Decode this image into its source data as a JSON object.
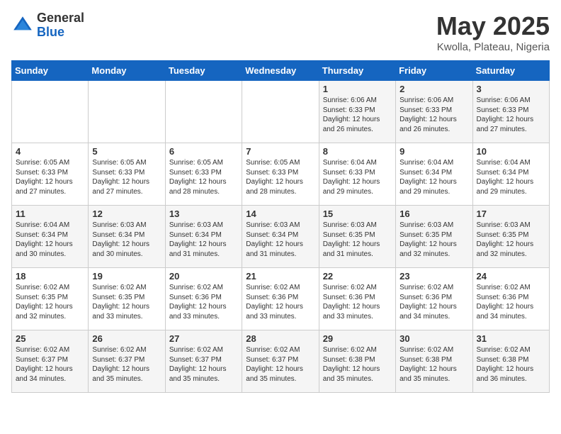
{
  "header": {
    "logo_general": "General",
    "logo_blue": "Blue",
    "title": "May 2025",
    "subtitle": "Kwolla, Plateau, Nigeria"
  },
  "weekdays": [
    "Sunday",
    "Monday",
    "Tuesday",
    "Wednesday",
    "Thursday",
    "Friday",
    "Saturday"
  ],
  "weeks": [
    [
      {
        "day": "",
        "info": ""
      },
      {
        "day": "",
        "info": ""
      },
      {
        "day": "",
        "info": ""
      },
      {
        "day": "",
        "info": ""
      },
      {
        "day": "1",
        "info": "Sunrise: 6:06 AM\nSunset: 6:33 PM\nDaylight: 12 hours\nand 26 minutes."
      },
      {
        "day": "2",
        "info": "Sunrise: 6:06 AM\nSunset: 6:33 PM\nDaylight: 12 hours\nand 26 minutes."
      },
      {
        "day": "3",
        "info": "Sunrise: 6:06 AM\nSunset: 6:33 PM\nDaylight: 12 hours\nand 27 minutes."
      }
    ],
    [
      {
        "day": "4",
        "info": "Sunrise: 6:05 AM\nSunset: 6:33 PM\nDaylight: 12 hours\nand 27 minutes."
      },
      {
        "day": "5",
        "info": "Sunrise: 6:05 AM\nSunset: 6:33 PM\nDaylight: 12 hours\nand 27 minutes."
      },
      {
        "day": "6",
        "info": "Sunrise: 6:05 AM\nSunset: 6:33 PM\nDaylight: 12 hours\nand 28 minutes."
      },
      {
        "day": "7",
        "info": "Sunrise: 6:05 AM\nSunset: 6:33 PM\nDaylight: 12 hours\nand 28 minutes."
      },
      {
        "day": "8",
        "info": "Sunrise: 6:04 AM\nSunset: 6:33 PM\nDaylight: 12 hours\nand 29 minutes."
      },
      {
        "day": "9",
        "info": "Sunrise: 6:04 AM\nSunset: 6:34 PM\nDaylight: 12 hours\nand 29 minutes."
      },
      {
        "day": "10",
        "info": "Sunrise: 6:04 AM\nSunset: 6:34 PM\nDaylight: 12 hours\nand 29 minutes."
      }
    ],
    [
      {
        "day": "11",
        "info": "Sunrise: 6:04 AM\nSunset: 6:34 PM\nDaylight: 12 hours\nand 30 minutes."
      },
      {
        "day": "12",
        "info": "Sunrise: 6:03 AM\nSunset: 6:34 PM\nDaylight: 12 hours\nand 30 minutes."
      },
      {
        "day": "13",
        "info": "Sunrise: 6:03 AM\nSunset: 6:34 PM\nDaylight: 12 hours\nand 31 minutes."
      },
      {
        "day": "14",
        "info": "Sunrise: 6:03 AM\nSunset: 6:34 PM\nDaylight: 12 hours\nand 31 minutes."
      },
      {
        "day": "15",
        "info": "Sunrise: 6:03 AM\nSunset: 6:35 PM\nDaylight: 12 hours\nand 31 minutes."
      },
      {
        "day": "16",
        "info": "Sunrise: 6:03 AM\nSunset: 6:35 PM\nDaylight: 12 hours\nand 32 minutes."
      },
      {
        "day": "17",
        "info": "Sunrise: 6:03 AM\nSunset: 6:35 PM\nDaylight: 12 hours\nand 32 minutes."
      }
    ],
    [
      {
        "day": "18",
        "info": "Sunrise: 6:02 AM\nSunset: 6:35 PM\nDaylight: 12 hours\nand 32 minutes."
      },
      {
        "day": "19",
        "info": "Sunrise: 6:02 AM\nSunset: 6:35 PM\nDaylight: 12 hours\nand 33 minutes."
      },
      {
        "day": "20",
        "info": "Sunrise: 6:02 AM\nSunset: 6:36 PM\nDaylight: 12 hours\nand 33 minutes."
      },
      {
        "day": "21",
        "info": "Sunrise: 6:02 AM\nSunset: 6:36 PM\nDaylight: 12 hours\nand 33 minutes."
      },
      {
        "day": "22",
        "info": "Sunrise: 6:02 AM\nSunset: 6:36 PM\nDaylight: 12 hours\nand 33 minutes."
      },
      {
        "day": "23",
        "info": "Sunrise: 6:02 AM\nSunset: 6:36 PM\nDaylight: 12 hours\nand 34 minutes."
      },
      {
        "day": "24",
        "info": "Sunrise: 6:02 AM\nSunset: 6:36 PM\nDaylight: 12 hours\nand 34 minutes."
      }
    ],
    [
      {
        "day": "25",
        "info": "Sunrise: 6:02 AM\nSunset: 6:37 PM\nDaylight: 12 hours\nand 34 minutes."
      },
      {
        "day": "26",
        "info": "Sunrise: 6:02 AM\nSunset: 6:37 PM\nDaylight: 12 hours\nand 35 minutes."
      },
      {
        "day": "27",
        "info": "Sunrise: 6:02 AM\nSunset: 6:37 PM\nDaylight: 12 hours\nand 35 minutes."
      },
      {
        "day": "28",
        "info": "Sunrise: 6:02 AM\nSunset: 6:37 PM\nDaylight: 12 hours\nand 35 minutes."
      },
      {
        "day": "29",
        "info": "Sunrise: 6:02 AM\nSunset: 6:38 PM\nDaylight: 12 hours\nand 35 minutes."
      },
      {
        "day": "30",
        "info": "Sunrise: 6:02 AM\nSunset: 6:38 PM\nDaylight: 12 hours\nand 35 minutes."
      },
      {
        "day": "31",
        "info": "Sunrise: 6:02 AM\nSunset: 6:38 PM\nDaylight: 12 hours\nand 36 minutes."
      }
    ]
  ]
}
